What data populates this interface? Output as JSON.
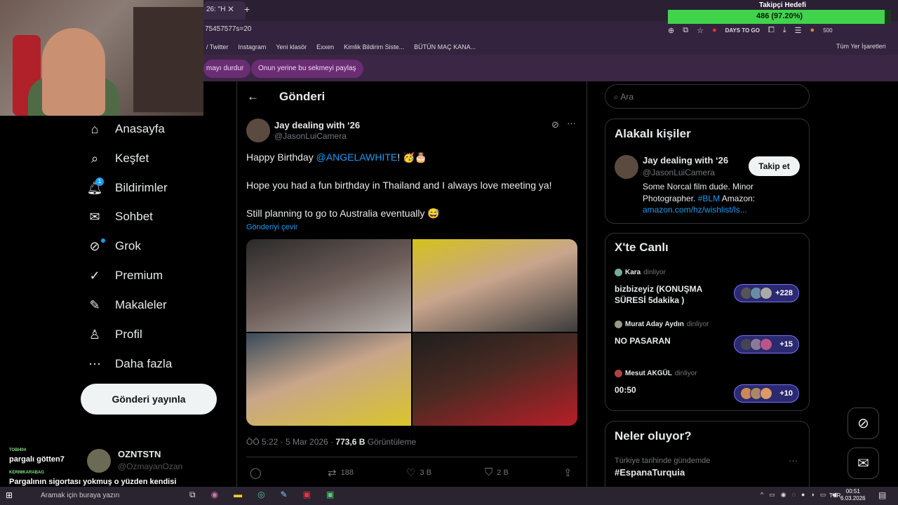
{
  "browser": {
    "tab_title": "26: \"H",
    "url_fragment": "75457577s=20",
    "bookmarks": [
      "/ Twitter",
      "Instagram",
      "Yeni klasör",
      "Exxen",
      "Kimlik Bildirim Siste...",
      "BÜTÜN MAÇ KANA..."
    ],
    "all_bookmarks": "Tüm Yer İşaretleri",
    "share_stop": "mayı durdur",
    "share_instead": "Onun yerine bu sekmeyi paylaş",
    "toolbar_text": "DAYS TO GO",
    "toolbar_count": "500"
  },
  "overlay": {
    "goal_title": "Takipçi Hedefi",
    "goal_text": "486 (97.20%)",
    "goal_fraction": 0.972,
    "chat": [
      {
        "user": "TOBI404",
        "msg": "pargalı götten7"
      },
      {
        "user": "KERIMKARABAG",
        "msg": "Pargalının sigortası yokmuş o yüzden kendisi çıkarttı"
      }
    ],
    "chat_card_name": "OZNTSTN",
    "chat_card_handle": "@OzmayanOzan"
  },
  "nav": {
    "items": [
      {
        "label": "Anasayfa",
        "icon": "home-icon"
      },
      {
        "label": "Keşfet",
        "icon": "search-icon"
      },
      {
        "label": "Bildirimler",
        "icon": "bell-icon"
      },
      {
        "label": "Sohbet",
        "icon": "mail-icon"
      },
      {
        "label": "Grok",
        "icon": "grok-icon"
      },
      {
        "label": "Premium",
        "icon": "verified-icon"
      },
      {
        "label": "Makaleler",
        "icon": "article-icon"
      },
      {
        "label": "Profil",
        "icon": "person-icon"
      },
      {
        "label": "Daha fazla",
        "icon": "more-icon"
      }
    ],
    "notif_count": "1",
    "post_button": "Gönderi yayınla"
  },
  "post": {
    "page_title": "Gönderi",
    "author_name": "Jay dealing with ‘26",
    "author_handle": "@JasonLuiCamera",
    "line1_prefix": "Happy Birthday ",
    "line1_mention": "@ANGELAWHITE",
    "line1_suffix": "! 🥳🎂",
    "line2": "Hope you had a fun birthday in Thailand and I always love meeting ya!",
    "line3": "Still planning to go to Australia eventually 😅",
    "translate": "Gönderiyi çevir",
    "time": "ÖÖ 5:22 · 5 Mar 2026 · ",
    "views_count": "773,6 B",
    "views_label": " Görüntüleme",
    "retweets": "188",
    "likes": "3 B",
    "bookmarks": "2 B"
  },
  "right": {
    "search_placeholder": "Ara",
    "relevant_title": "Alakalı kişiler",
    "rp_name": "Jay dealing with ‘26",
    "rp_handle": "@JasonLuiCamera",
    "rp_bio1": "Some Norcal film dude. Minor",
    "rp_bio2_prefix": "Photographer. ",
    "rp_bio2_tag": "#BLM",
    "rp_bio2_suffix": " Amazon:",
    "rp_link": "amazon.com/hz/wishlist/ls...",
    "follow": "Takip et",
    "live_title": "X'te Canlı",
    "listening": "dinliyor",
    "spaces": [
      {
        "host": "Kara",
        "title": "bizbizeyiz (KONUŞMA SÜRESİ 5dakika )",
        "count": "+228"
      },
      {
        "host": "Murat Aday Aydın",
        "title": "NO PASARAN",
        "count": "+15"
      },
      {
        "host": "Mesut AKGÜL",
        "title": "00:50",
        "count": "+10"
      }
    ],
    "trends_title": "Neler oluyor?",
    "trend_context": "Türkiye tarihinde gündemde",
    "trend_name": "#EspanaTurquia"
  },
  "taskbar": {
    "search": "Aramak için buraya yazın",
    "lang": "TUR",
    "time": "00:51",
    "date": "6.03.2026"
  },
  "colors": {
    "accent": "#1d9bf0",
    "live_border": "#7a72ff",
    "goal_fill": "#3fd44b"
  }
}
